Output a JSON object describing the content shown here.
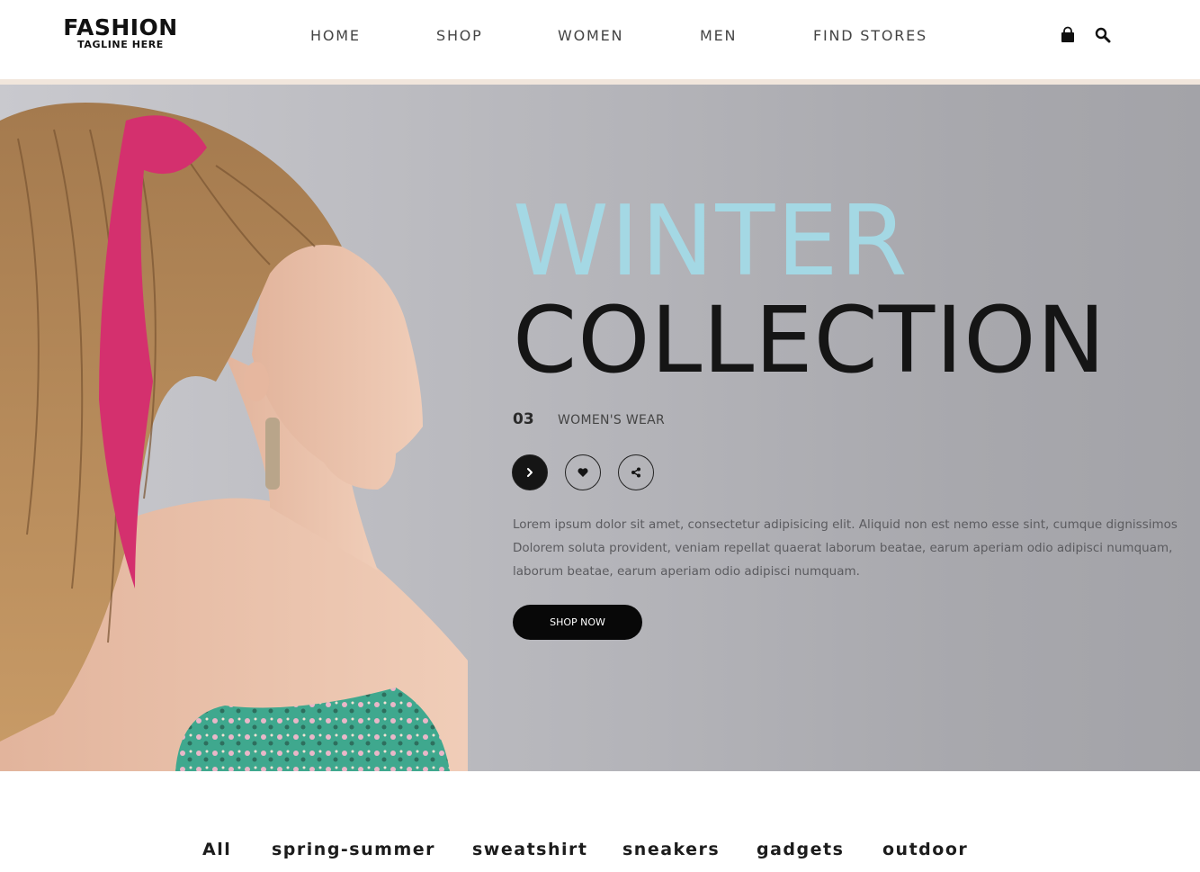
{
  "brand": {
    "name": "FASHION",
    "tagline": "TAGLINE HERE"
  },
  "nav": {
    "items": [
      {
        "label": "HOME"
      },
      {
        "label": "SHOP"
      },
      {
        "label": "WOMEN"
      },
      {
        "label": "MEN"
      },
      {
        "label": "FIND STORES"
      }
    ]
  },
  "header_icons": {
    "cart": "shopping-bag-icon",
    "search": "search-icon"
  },
  "hero": {
    "title_line1": "WINTER",
    "title_line2": "COLLECTION",
    "slide_number": "03",
    "category": "WOMEN'S WEAR",
    "buttons": {
      "next": "chevron-right-icon",
      "like": "heart-icon",
      "share": "share-icon"
    },
    "description": [
      "Lorem ipsum dolor sit amet, consectetur adipisicing elit. Aliquid non est nemo esse sint, cumque dignissimos",
      "Dolorem soluta provident, veniam repellat quaerat laborum beatae, earum aperiam odio adipisci numquam,",
      "laborum beatae, earum aperiam odio adipisci numquam."
    ],
    "cta_label": "SHOP NOW"
  },
  "filters": [
    "All",
    "spring-summer",
    "sweatshirt",
    "sneakers",
    "gadgets",
    "outdoor"
  ],
  "colors": {
    "accent_light_blue": "#a4d8e4",
    "dark": "#151515",
    "hero_bg": "#b3b3b8",
    "header_rule": "#f1e6dc"
  }
}
